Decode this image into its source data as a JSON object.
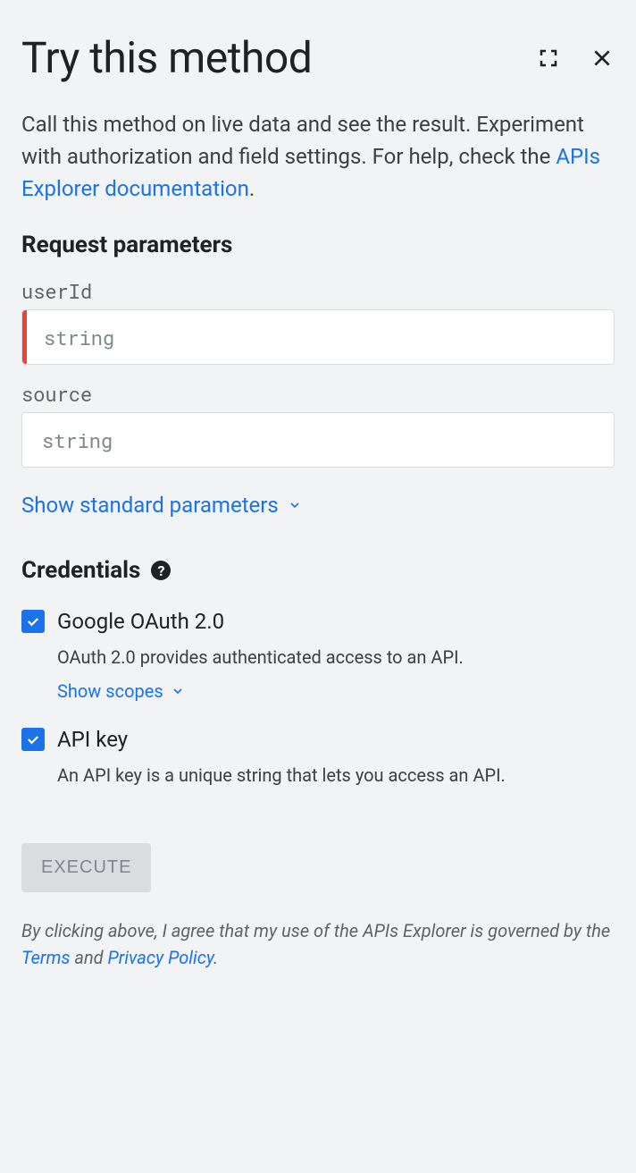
{
  "header": {
    "title": "Try this method"
  },
  "intro": {
    "text_before_link": "Call this method on live data and see the result. Experiment with authorization and field settings. For help, check the ",
    "link_text": "APIs Explorer documentation",
    "after": "."
  },
  "params": {
    "heading": "Request parameters",
    "items": [
      {
        "name": "userId",
        "placeholder": "string",
        "required": true
      },
      {
        "name": "source",
        "placeholder": "string",
        "required": false
      }
    ],
    "show_standard": "Show standard parameters"
  },
  "credentials": {
    "heading": "Credentials",
    "oauth": {
      "label": "Google OAuth 2.0",
      "desc": "OAuth 2.0 provides authenticated access to an API.",
      "scopes": "Show scopes",
      "checked": true
    },
    "apikey": {
      "label": "API key",
      "desc": "An API key is a unique string that lets you access an API.",
      "checked": true
    }
  },
  "execute": "EXECUTE",
  "disclaimer": {
    "before": "By clicking above, I agree that my use of the APIs Explorer is governed by the ",
    "terms": "Terms",
    "mid": " and ",
    "privacy": "Privacy Policy",
    "after": "."
  }
}
